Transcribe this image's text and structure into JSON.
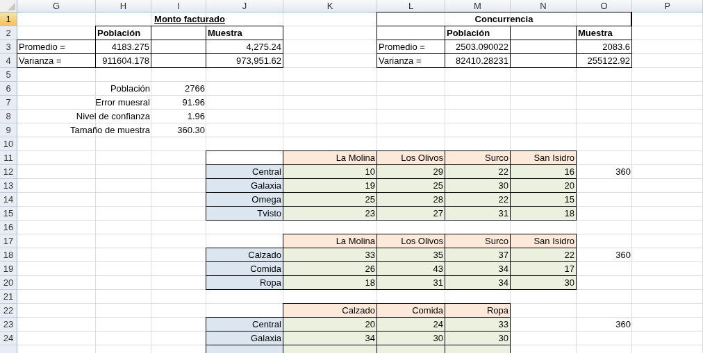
{
  "column_headers": [
    "G",
    "H",
    "I",
    "J",
    "K",
    "L",
    "M",
    "N",
    "O",
    "P"
  ],
  "rows": [
    {
      "number": "1",
      "selected": true,
      "cells": [
        null,
        {
          "kind": "title",
          "text": "Monto facturado"
        },
        {
          "kind": "merged"
        },
        {
          "kind": "merged"
        },
        null,
        {
          "kind": "title-box",
          "text": "Concurrencia"
        },
        {
          "kind": "merged"
        },
        {
          "kind": "merged"
        },
        {
          "kind": "merged"
        },
        null
      ]
    },
    {
      "number": "2",
      "selected": false,
      "cells": [
        null,
        {
          "kind": "head",
          "text": "Población"
        },
        {
          "kind": "blank-box"
        },
        {
          "kind": "head",
          "text": "Muestra"
        },
        null,
        {
          "kind": "blank-box"
        },
        {
          "kind": "head",
          "text": "Población"
        },
        {
          "kind": "blank-box"
        },
        {
          "kind": "head",
          "text": "Muestra"
        },
        null
      ]
    },
    {
      "number": "3",
      "selected": false,
      "cells": [
        {
          "kind": "label",
          "text": "Promedio ="
        },
        {
          "kind": "num",
          "text": "4183.275"
        },
        {
          "kind": "blank-box"
        },
        {
          "kind": "num",
          "text": "4,275.24"
        },
        null,
        {
          "kind": "label",
          "text": "Promedio ="
        },
        {
          "kind": "num",
          "text": "2503.090022"
        },
        {
          "kind": "blank-box"
        },
        {
          "kind": "num",
          "text": "2083.6"
        },
        null
      ]
    },
    {
      "number": "4",
      "selected": false,
      "cells": [
        {
          "kind": "label",
          "text": "Varianza ="
        },
        {
          "kind": "num",
          "text": "911604.178"
        },
        {
          "kind": "blank-box"
        },
        {
          "kind": "num",
          "text": "973,951.62"
        },
        null,
        {
          "kind": "label",
          "text": "Varianza ="
        },
        {
          "kind": "num",
          "text": "82410.28231"
        },
        {
          "kind": "blank-box"
        },
        {
          "kind": "num",
          "text": "255122.92"
        },
        null
      ]
    },
    {
      "number": "5",
      "selected": false,
      "cells": []
    },
    {
      "number": "6",
      "selected": false,
      "cells": [
        {
          "kind": "caption",
          "text": "Población"
        },
        {
          "kind": "merged"
        },
        {
          "kind": "value",
          "text": "2766"
        }
      ]
    },
    {
      "number": "7",
      "selected": false,
      "cells": [
        {
          "kind": "caption",
          "text": "Error muesral"
        },
        {
          "kind": "merged"
        },
        {
          "kind": "value",
          "text": "91.96"
        }
      ]
    },
    {
      "number": "8",
      "selected": false,
      "cells": [
        {
          "kind": "caption",
          "text": "Nivel de confianza"
        },
        {
          "kind": "merged"
        },
        {
          "kind": "value",
          "text": "1.96"
        }
      ]
    },
    {
      "number": "9",
      "selected": false,
      "cells": [
        {
          "kind": "caption",
          "text": "Tamaño de muestra"
        },
        {
          "kind": "merged"
        },
        {
          "kind": "value",
          "text": "360.30"
        }
      ]
    },
    {
      "number": "10",
      "selected": false,
      "cells": []
    },
    {
      "number": "11",
      "selected": false,
      "cells": [
        null,
        null,
        null,
        {
          "kind": "corner"
        },
        {
          "kind": "col-head",
          "text": "La Molina"
        },
        {
          "kind": "col-head",
          "text": "Los Olivos"
        },
        {
          "kind": "col-head",
          "text": "Surco"
        },
        {
          "kind": "col-head",
          "text": "San Isidro"
        }
      ]
    },
    {
      "number": "12",
      "selected": false,
      "cells": [
        null,
        null,
        null,
        {
          "kind": "row-head",
          "text": "Central"
        },
        {
          "kind": "data",
          "text": "10"
        },
        {
          "kind": "data",
          "text": "29"
        },
        {
          "kind": "data",
          "text": "22"
        },
        {
          "kind": "data",
          "text": "16"
        },
        {
          "kind": "value",
          "text": "360"
        }
      ]
    },
    {
      "number": "13",
      "selected": false,
      "cells": [
        null,
        null,
        null,
        {
          "kind": "row-head",
          "text": "Galaxia"
        },
        {
          "kind": "data",
          "text": "19"
        },
        {
          "kind": "data",
          "text": "25"
        },
        {
          "kind": "data",
          "text": "30"
        },
        {
          "kind": "data",
          "text": "20"
        }
      ]
    },
    {
      "number": "14",
      "selected": false,
      "cells": [
        null,
        null,
        null,
        {
          "kind": "row-head",
          "text": "Omega"
        },
        {
          "kind": "data",
          "text": "25"
        },
        {
          "kind": "data",
          "text": "28"
        },
        {
          "kind": "data",
          "text": "22"
        },
        {
          "kind": "data",
          "text": "15"
        }
      ]
    },
    {
      "number": "15",
      "selected": false,
      "cells": [
        null,
        null,
        null,
        {
          "kind": "row-head",
          "text": "Tvisto"
        },
        {
          "kind": "data",
          "text": "23"
        },
        {
          "kind": "data",
          "text": "27"
        },
        {
          "kind": "data",
          "text": "31"
        },
        {
          "kind": "data",
          "text": "18"
        }
      ]
    },
    {
      "number": "16",
      "selected": false,
      "cells": []
    },
    {
      "number": "17",
      "selected": false,
      "cells": [
        null,
        null,
        null,
        null,
        {
          "kind": "col-head",
          "text": "La Molina"
        },
        {
          "kind": "col-head",
          "text": "Los Olivos"
        },
        {
          "kind": "col-head",
          "text": "Surco"
        },
        {
          "kind": "col-head",
          "text": "San Isidro"
        }
      ]
    },
    {
      "number": "18",
      "selected": false,
      "cells": [
        null,
        null,
        null,
        {
          "kind": "row-head",
          "text": "Calzado"
        },
        {
          "kind": "data",
          "text": "33"
        },
        {
          "kind": "data",
          "text": "35"
        },
        {
          "kind": "data",
          "text": "37"
        },
        {
          "kind": "data",
          "text": "22"
        },
        {
          "kind": "value",
          "text": "360"
        }
      ]
    },
    {
      "number": "19",
      "selected": false,
      "cells": [
        null,
        null,
        null,
        {
          "kind": "row-head",
          "text": "Comida"
        },
        {
          "kind": "data",
          "text": "26"
        },
        {
          "kind": "data",
          "text": "43"
        },
        {
          "kind": "data",
          "text": "34"
        },
        {
          "kind": "data",
          "text": "17"
        }
      ]
    },
    {
      "number": "20",
      "selected": false,
      "cells": [
        null,
        null,
        null,
        {
          "kind": "row-head",
          "text": "Ropa"
        },
        {
          "kind": "data",
          "text": "18"
        },
        {
          "kind": "data",
          "text": "31"
        },
        {
          "kind": "data",
          "text": "34"
        },
        {
          "kind": "data",
          "text": "30"
        }
      ]
    },
    {
      "number": "21",
      "selected": false,
      "cells": []
    },
    {
      "number": "22",
      "selected": false,
      "cells": [
        null,
        null,
        null,
        null,
        {
          "kind": "col-head",
          "text": "Calzado"
        },
        {
          "kind": "col-head",
          "text": "Comida"
        },
        {
          "kind": "col-head",
          "text": "Ropa"
        }
      ]
    },
    {
      "number": "23",
      "selected": false,
      "cells": [
        null,
        null,
        null,
        {
          "kind": "row-head",
          "text": "Central"
        },
        {
          "kind": "data",
          "text": "20"
        },
        {
          "kind": "data",
          "text": "24"
        },
        {
          "kind": "data",
          "text": "33"
        },
        null,
        {
          "kind": "value",
          "text": "360"
        }
      ]
    },
    {
      "number": "24",
      "selected": false,
      "cells": [
        null,
        null,
        null,
        {
          "kind": "row-head",
          "text": "Galaxia"
        },
        {
          "kind": "data",
          "text": "34"
        },
        {
          "kind": "data",
          "text": "30"
        },
        {
          "kind": "data",
          "text": "30"
        }
      ]
    },
    {
      "selected": false,
      "cells": [
        null,
        null,
        null,
        {
          "kind": "row-head"
        },
        {
          "kind": "data"
        },
        {
          "kind": "data"
        },
        {
          "kind": "data"
        }
      ]
    }
  ]
}
